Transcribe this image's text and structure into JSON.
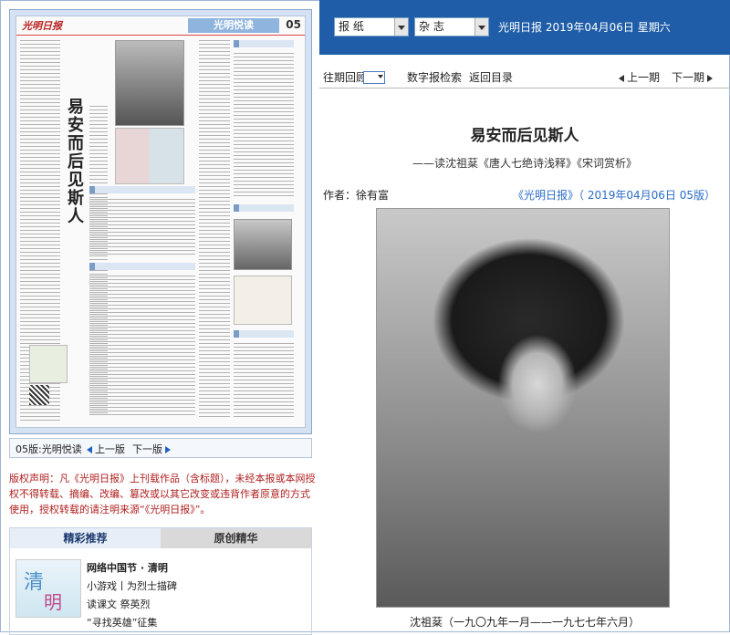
{
  "left": {
    "paper": {
      "section_banner": "光明悦读",
      "page_number": "05",
      "headline": "易安而后见斯人"
    },
    "nav": {
      "edition_label": "05版:光明悦读",
      "prev_label": "上一版",
      "next_label": "下一版"
    },
    "copyright": "版权声明：凡《光明日报》上刊载作品（含标题），未经本报或本网授权不得转载、摘编、改编、篡改或以其它改变或违背作者原意的方式使用，授权转载的请注明来源“《光明日报》”。",
    "recommend": {
      "tab_active": "精彩推荐",
      "tab_inactive": "原创精华",
      "thumb_text_1": "清",
      "thumb_text_2": "明",
      "items": [
        "网络中国节 · 清明",
        "小游戏丨为烈士描碑",
        "读课文 祭英烈",
        "“寻找英雄”征集"
      ]
    }
  },
  "right": {
    "select_paper": "报 纸",
    "select_magazine": "杂 志",
    "top_info": "光明日报 2019年04月06日 星期六",
    "toolbar": {
      "period_review": "往期回顾",
      "digital_search": "数字报检索",
      "back_to_index": "返回目录",
      "prev_issue": "上一期",
      "next_issue": "下一期"
    },
    "article": {
      "title": "易安而后见斯人",
      "subtitle": "——读沈祖棻《唐人七绝诗浅释》《宋词赏析》",
      "author": "作者：徐有富",
      "source": "《光明日报》（ 2019年04月06日 05版）",
      "caption": "沈祖棻（一九〇九年一月——一九七七年六月）"
    }
  },
  "colors": {
    "header_blue": "#1f5da8",
    "link_blue": "#2a6bc8",
    "copyright_red": "#b02020"
  }
}
